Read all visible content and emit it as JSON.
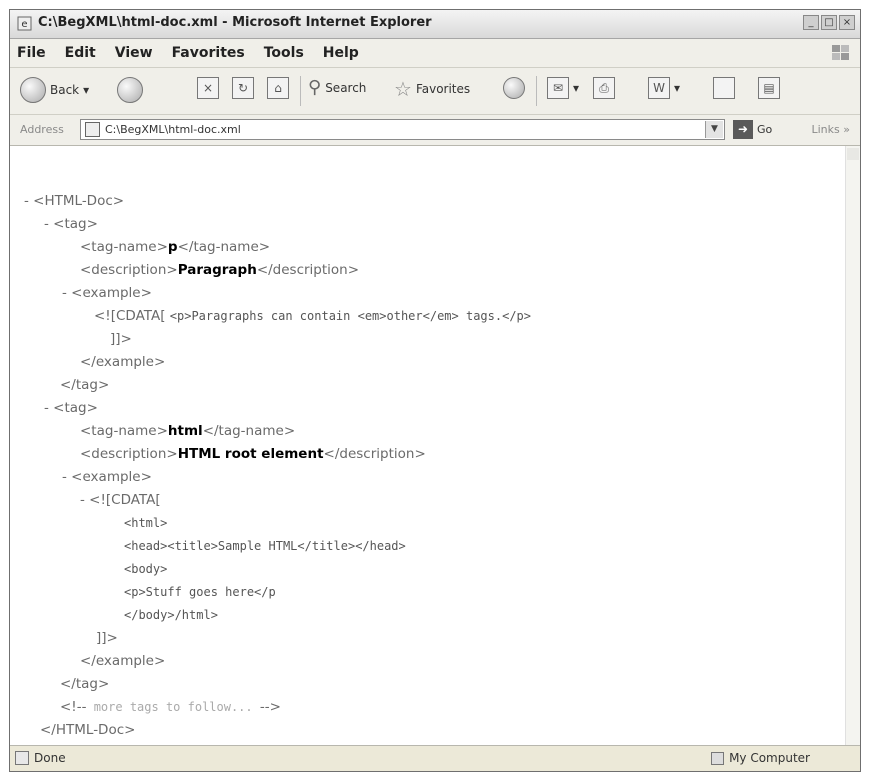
{
  "window": {
    "title": "C:\\BegXML\\html-doc.xml - Microsoft Internet Explorer",
    "buttons": [
      "_",
      "□",
      "×"
    ]
  },
  "menu": [
    "File",
    "Edit",
    "View",
    "Favorites",
    "Tools",
    "Help"
  ],
  "toolbar": {
    "back": "Back",
    "search": "Search",
    "favorites": "Favorites"
  },
  "address": {
    "label": "Address",
    "value": "C:\\BegXML\\html-doc.xml",
    "go": "Go",
    "links": "Links"
  },
  "doc": [
    {
      "toggle": "-",
      "text": "<HTML-Doc>"
    },
    {
      "toggle": "-",
      "text": "<tag>"
    },
    {
      "toggle": "",
      "pre": "<tag-name>",
      "val": "p",
      "post": "</tag-name>"
    },
    {
      "toggle": "",
      "pre": "<description>",
      "val": "Paragraph",
      "post": "</description>"
    },
    {
      "toggle": "-",
      "text": "<example>"
    },
    {
      "toggle": "",
      "pre": "<![CDATA[ ",
      "code": "<p>Paragraphs can contain <em>other</em> tags.</p>"
    },
    {
      "toggle": "",
      "text": "]]>"
    },
    {
      "toggle": "",
      "text": "</example>"
    },
    {
      "toggle": "",
      "text": "</tag>"
    },
    {
      "toggle": "-",
      "text": "<tag>"
    },
    {
      "toggle": "",
      "pre": "<tag-name>",
      "val": "html",
      "post": "</tag-name>"
    },
    {
      "toggle": "",
      "pre": "<description>",
      "val": "HTML root element",
      "post": "</description>"
    },
    {
      "toggle": "-",
      "text": "<example>"
    },
    {
      "toggle": "-",
      "text": "<![CDATA["
    },
    {
      "toggle": "",
      "code": "<html>"
    },
    {
      "toggle": "",
      "code": "<head><title>Sample HTML</title></head>"
    },
    {
      "toggle": "",
      "code": "<body>"
    },
    {
      "toggle": "",
      "code": "<p>Stuff goes here</p"
    },
    {
      "toggle": "",
      "code": "</body>/html>"
    },
    {
      "toggle": "",
      "text": "]]>"
    },
    {
      "toggle": "",
      "text": "</example>"
    },
    {
      "toggle": "",
      "text": "</tag>"
    },
    {
      "toggle": "",
      "pre": "<!--",
      "comment": " more tags to follow... ",
      "post": "-->"
    },
    {
      "toggle": "",
      "text": "</HTML-Doc>"
    }
  ],
  "status": {
    "left": "Done",
    "zone": "My Computer"
  }
}
